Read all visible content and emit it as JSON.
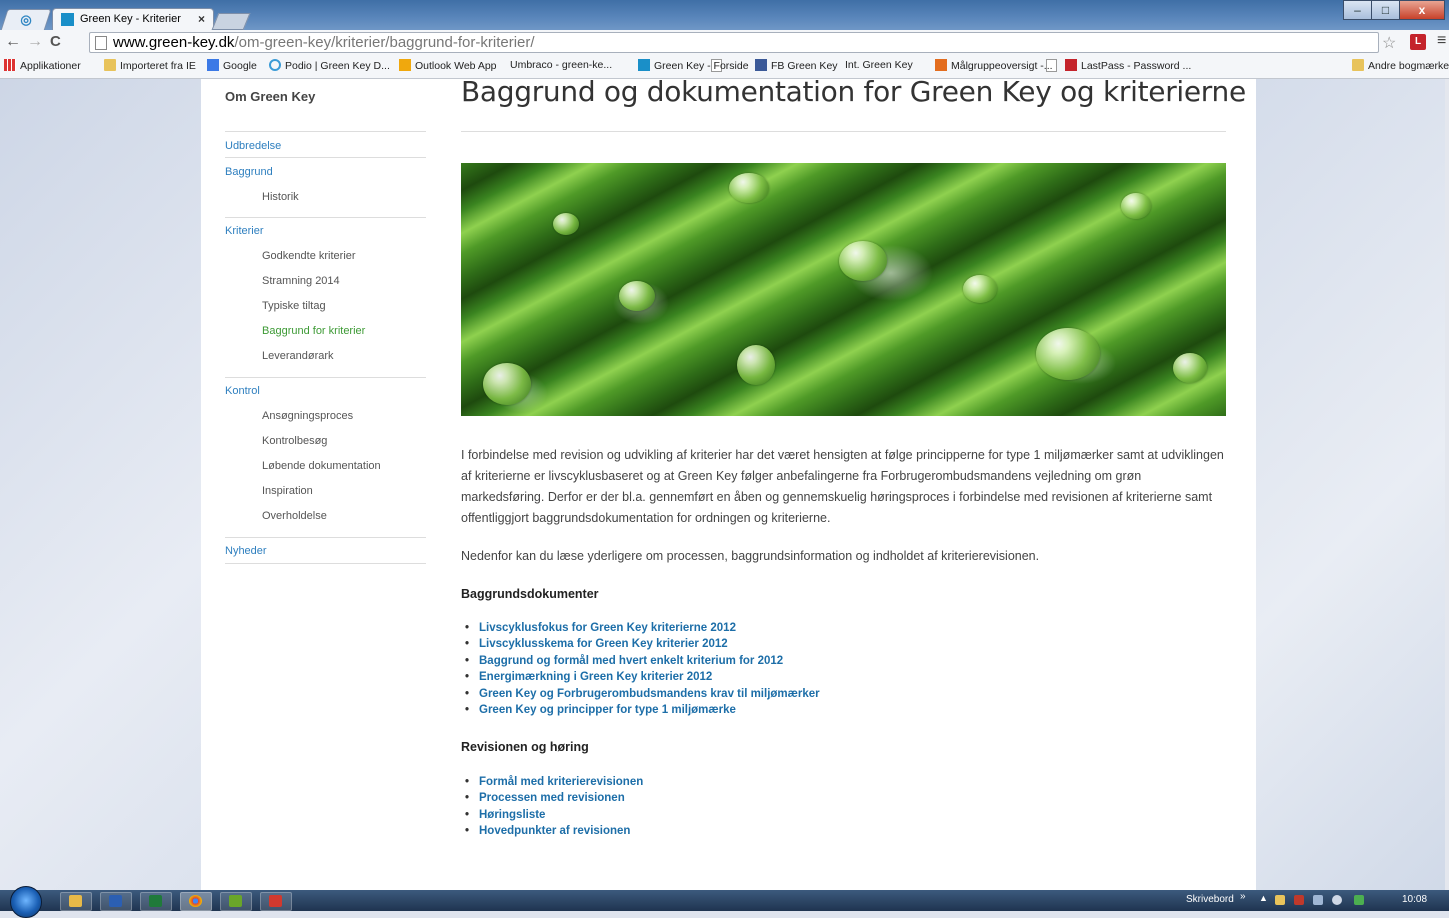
{
  "browser": {
    "tab_title": "Green Key - Kriterier",
    "tab_close": "×",
    "url_domain": "www.green-key.dk",
    "url_path": "/om-green-key/kriterier/baggrund-for-kriterier/",
    "back": "←",
    "forward": "→",
    "reload": "C",
    "star": "☆",
    "menu": "≡",
    "window_minimize": "–",
    "window_maximize": "□",
    "window_close": "x"
  },
  "bookmarks": [
    {
      "label": "Applikationer",
      "icon": "apps-icon"
    },
    {
      "label": "Importeret fra IE",
      "icon": "folder-icon"
    },
    {
      "label": "Google",
      "icon": "google-icon"
    },
    {
      "label": "Podio | Green Key D...",
      "icon": "podio-icon"
    },
    {
      "label": "Outlook Web App",
      "icon": "outlook-icon"
    },
    {
      "label": "Umbraco - green-ke...",
      "icon": "page-icon"
    },
    {
      "label": "Green Key - Forside",
      "icon": "greenkey-icon"
    },
    {
      "label": "FB Green Key",
      "icon": "facebook-icon"
    },
    {
      "label": "Int. Green Key",
      "icon": "page-icon"
    },
    {
      "label": "Målgruppeoversigt -...",
      "icon": "chart-icon"
    },
    {
      "label": "LastPass - Password ...",
      "icon": "lastpass-icon"
    },
    {
      "label": "Andre bogmærker",
      "icon": "folder-icon"
    }
  ],
  "sidebar": {
    "title": "Om Green Key",
    "items": {
      "udbredelse": "Udbredelse",
      "baggrund": "Baggrund",
      "historik": "Historik",
      "kriterier": "Kriterier",
      "godkendte": "Godkendte kriterier",
      "stramning": "Stramning 2014",
      "typiske": "Typiske tiltag",
      "baggrund_kriterier": "Baggrund for kriterier",
      "leverandoerark": "Leverandørark",
      "kontrol": "Kontrol",
      "ansoegning": "Ansøgningsproces",
      "kontrolbesoeg": "Kontrolbesøg",
      "loebende": "Løbende dokumentation",
      "inspiration": "Inspiration",
      "overholdelse": "Overholdelse",
      "nyheder": "Nyheder"
    }
  },
  "main": {
    "title": "Baggrund og dokumentation for Green Key og kriterierne",
    "intro": "I forbindelse med revision og udvikling af kriterier har det været hensigten at følge principperne for type 1 miljømærker samt at udviklingen af kriterierne er livscyklusbaseret og at Green Key følger anbefalingerne fra Forbrugerombudsmandens vejledning om grøn markedsføring. Derfor er der bl.a. gennemført en åben og gennemskuelig høringsproces i forbindelse med revisionen af kriterierne samt offentliggjort baggrundsdokumentation for ordningen og kriterierne.",
    "lead": "Nedenfor kan du læse yderligere om processen, baggrundsinformation og indholdet af kriterierevisionen.",
    "docs_heading": "Baggrundsdokumenter",
    "docs": [
      "Livscyklusfokus for Green Key kriterierne 2012",
      "Livscyklusskema for Green Key kriterier 2012",
      "Baggrund og formål med hvert enkelt kriterium for 2012",
      "Energimærkning i Green Key kriterier 2012",
      "Green Key og Forbrugerombudsmandens krav til miljømærker",
      "Green Key og principper for type 1 miljømærke"
    ],
    "revision_heading": "Revisionen og høring",
    "revision": [
      "Formål med kriterierevisionen",
      "Processen med revisionen",
      "Høringsliste",
      "Hovedpunkter af revisionen"
    ]
  },
  "taskbar": {
    "desktop_label": "Skrivebord",
    "chevron": "»",
    "clock": "10:08"
  },
  "colors": {
    "link": "#2e7fbf",
    "active_nav": "#3d9a35",
    "doc_link": "#1d6ea8"
  }
}
